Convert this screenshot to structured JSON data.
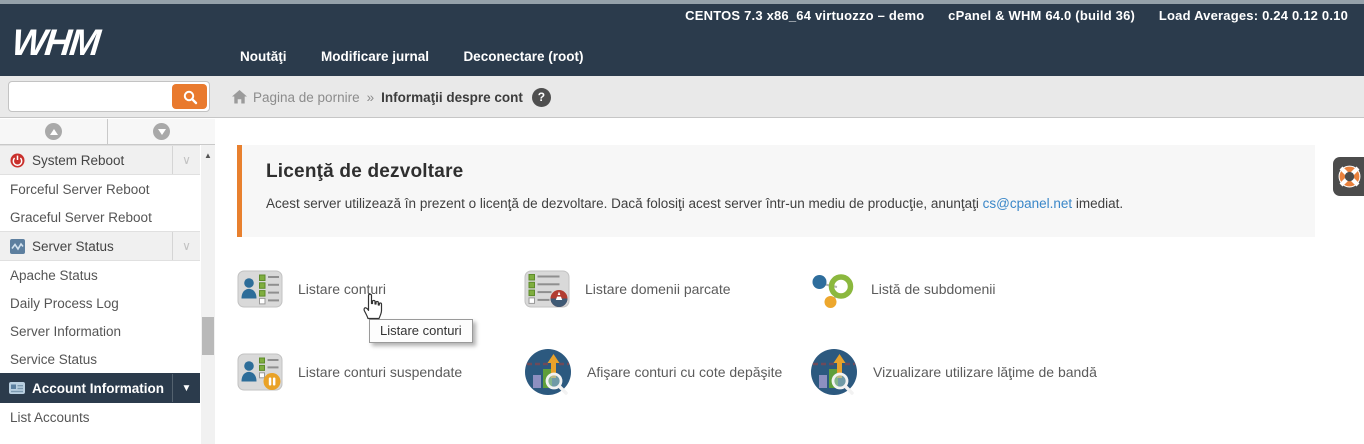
{
  "header": {
    "system_info": "CENTOS 7.3 x86_64 virtuozzo – demo",
    "version_info": "cPanel & WHM 64.0 (build 36)",
    "load_averages": "Load Averages: 0.24 0.12 0.10",
    "logo_text": "WHM",
    "nav": [
      {
        "label": "Noutăţi"
      },
      {
        "label": "Modificare jurnal"
      },
      {
        "label": "Deconectare (root)"
      }
    ]
  },
  "search": {
    "value": "",
    "placeholder": ""
  },
  "breadcrumb": {
    "home": "Pagina de pornire",
    "separator": "»",
    "current": "Informaţii despre cont",
    "help_glyph": "?"
  },
  "sidebar": {
    "items": [
      {
        "label": "System Reboot",
        "type": "group-header",
        "icon": "power-icon"
      },
      {
        "label": "Forceful Server Reboot",
        "type": "item"
      },
      {
        "label": "Graceful Server Reboot",
        "type": "item"
      },
      {
        "label": "Server Status",
        "type": "group-header",
        "icon": "status-chart-icon"
      },
      {
        "label": "Apache Status",
        "type": "item"
      },
      {
        "label": "Daily Process Log",
        "type": "item"
      },
      {
        "label": "Server Information",
        "type": "item"
      },
      {
        "label": "Service Status",
        "type": "item"
      },
      {
        "label": "Account Information",
        "type": "group-header-active",
        "icon": "id-card-icon"
      },
      {
        "label": "List Accounts",
        "type": "item"
      }
    ],
    "icons": {
      "chevron_collapsed": "∨",
      "chevron_expanded": "▼",
      "scroll_up_glyph": "▲"
    }
  },
  "notice": {
    "title": "Licenţă de dezvoltare",
    "body_before_link": "Acest server utilizează în prezent o licenţă de dezvoltare. Dacă folosiţi acest server într-un mediu de producţie, anunţaţi ",
    "link": "cs@cpanel.net",
    "body_after_link": " imediat."
  },
  "features": [
    {
      "label": "Listare conturi",
      "icon": "account-list-icon"
    },
    {
      "label": "Listare domenii parcate",
      "icon": "parked-domains-icon"
    },
    {
      "label": "Listă de subdomenii",
      "icon": "subdomains-icon"
    },
    {
      "label": "Listare conturi suspendate",
      "icon": "suspended-accounts-icon"
    },
    {
      "label": "Afişare conturi cu cote depăşite",
      "icon": "quota-exceeded-icon"
    },
    {
      "label": "Vizualizare utilizare lăţime de bandă",
      "icon": "bandwidth-usage-icon"
    }
  ],
  "tooltip": {
    "text": "Listare conturi"
  },
  "colors": {
    "header_navy": "#2b3b4c",
    "accent_orange": "#e8802e",
    "link_blue": "#3a87c8",
    "active_sidebar_bg": "#2b3b4c",
    "breadcrumb_bar": "#e9e9e9"
  }
}
